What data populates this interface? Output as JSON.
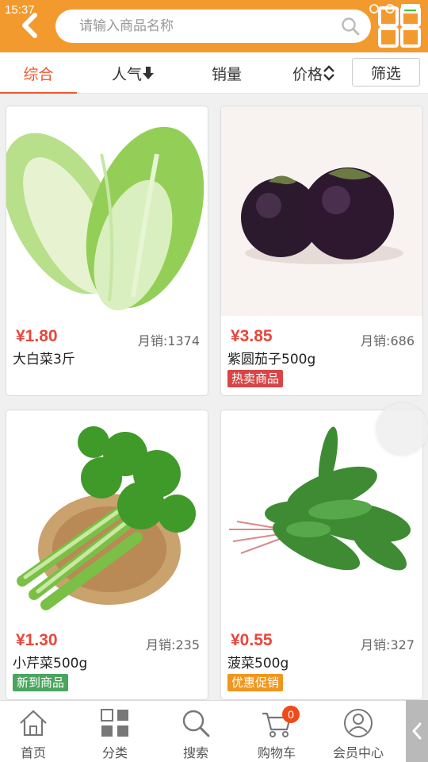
{
  "status_bar": {
    "time": "15:37"
  },
  "search": {
    "placeholder": "请输入商品名称",
    "value": ""
  },
  "tabs": {
    "items": [
      {
        "label": "综合",
        "active": true
      },
      {
        "label": "人气",
        "icon": "arrow-down-icon"
      },
      {
        "label": "销量"
      },
      {
        "label": "价格",
        "icon": "sort-up-down-icon"
      }
    ],
    "filter_label": "筛选"
  },
  "products": [
    {
      "price": "¥1.80",
      "sales_label": "月销:",
      "sales": "1374",
      "name": "大白菜3斤",
      "badge": ""
    },
    {
      "price": "¥3.85",
      "sales_label": "月销:",
      "sales": "686",
      "name": "紫圆茄子500g",
      "badge": "热卖商品",
      "badge_color": "#d84545"
    },
    {
      "price": "¥1.30",
      "sales_label": "月销:",
      "sales": "235",
      "name": "小芹菜500g",
      "badge": "新到商品",
      "badge_color": "#4aa55e"
    },
    {
      "price": "¥0.55",
      "sales_label": "月销:",
      "sales": "327",
      "name": "菠菜500g",
      "badge": "优惠促销",
      "badge_color": "#f0961e"
    }
  ],
  "bottom_nav": {
    "items": [
      {
        "label": "首页",
        "icon": "home-icon"
      },
      {
        "label": "分类",
        "icon": "category-icon"
      },
      {
        "label": "搜索",
        "icon": "search-icon"
      },
      {
        "label": "购物车",
        "icon": "cart-icon"
      },
      {
        "label": "会员中心",
        "icon": "user-icon"
      }
    ],
    "cart_count": "0"
  },
  "colors": {
    "header": "#f39a2e",
    "accent": "#f2572d",
    "price": "#e8473c"
  }
}
